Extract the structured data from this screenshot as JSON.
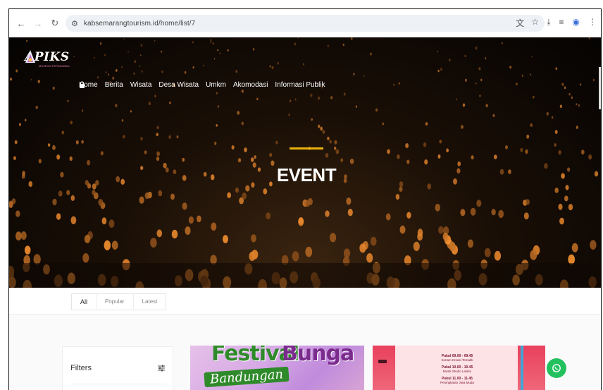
{
  "browser": {
    "url": "kabsemarangtourism.id/home/list/7"
  },
  "site": {
    "logo_text": "APIKS",
    "logo_tagline": "MUSEUM PERADABAN",
    "menu": [
      "Home",
      "Berita",
      "Wisata",
      "Desa Wisata",
      "Umkm",
      "Akomodasi",
      "Informasi Publik"
    ],
    "accent_color": "#e8b10c"
  },
  "hero": {
    "title": "EVENT"
  },
  "tabs": [
    "All",
    "Popular",
    "Latest"
  ],
  "filters": {
    "label": "Filters"
  },
  "cards": {
    "first": {
      "word1": "Festival",
      "word2": "Bunga",
      "subtitle": "Bandungan"
    },
    "second": {
      "lines": [
        {
          "time": "Pukul 09.00 - 09.45",
          "desc": "Senam Kreasi Tematik"
        },
        {
          "time": "Pukul 10.00 - 10.45",
          "desc": "Musik Studio Lalinto"
        },
        {
          "time": "Pukul 11.00 - 11.45",
          "desc": "Peningkatan Jiwa Muda"
        }
      ]
    }
  }
}
